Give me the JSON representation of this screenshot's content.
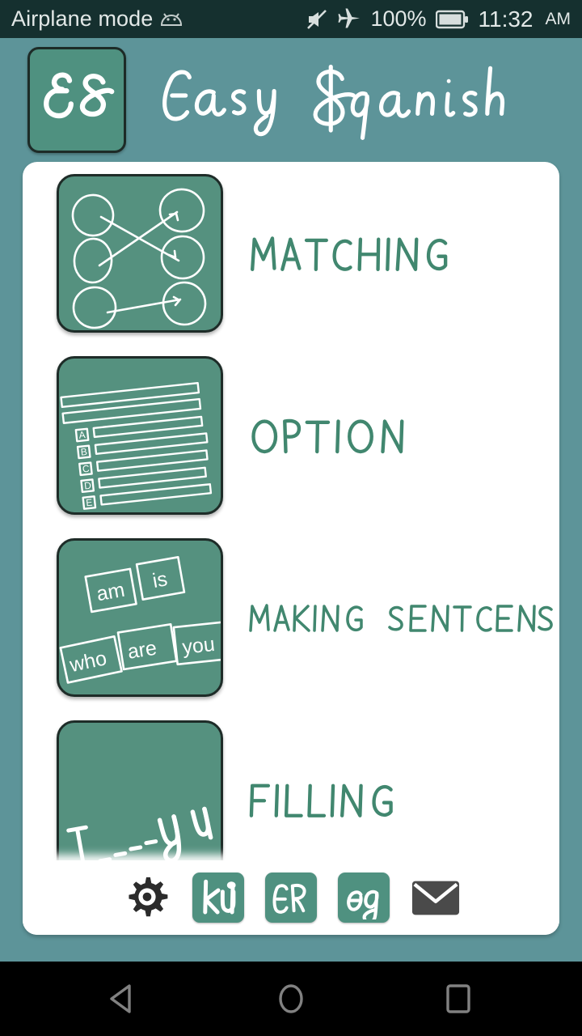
{
  "status_bar": {
    "left_text": "Airplane mode",
    "android_icon": "android-icon",
    "mute_icon": "volume-mute-icon",
    "airplane_icon": "airplane-mode-icon",
    "battery_percent": "100%",
    "battery_icon": "battery-full-icon",
    "time": "11:32",
    "ampm": "AM",
    "background_color": "#15302f",
    "text_color": "#e2e8e7"
  },
  "header": {
    "logo_text": "ES",
    "title": "Easy Spanish",
    "background_color": "#5d9499",
    "logo_tile_color": "#4f9180",
    "title_color": "#ffffff"
  },
  "colors": {
    "page_background": "#5d9499",
    "card_background": "#ffffff",
    "tile_green": "#55917f",
    "label_green": "#41876f",
    "icon_dark": "#4a4a4a"
  },
  "main": {
    "items": [
      {
        "label": "MATCHING",
        "icon": "matching-circles-icon",
        "icon_description": "six circles connected by three arrows"
      },
      {
        "label": "OPTION",
        "icon": "multiple-choice-icon",
        "icon_description": "question lines with A B C D E answer bars",
        "choices": [
          "A",
          "B",
          "C",
          "D",
          "E"
        ]
      },
      {
        "label": "MAKING SENTENCES",
        "icon": "word-tiles-icon",
        "icon_description": "scattered word tiles",
        "tiles": [
          "am",
          "is",
          "who",
          "are",
          "you"
        ]
      },
      {
        "label": "FILLING",
        "icon": "fill-in-the-blank-icon",
        "icon_description": "I ___ you handwritten blank",
        "sentence_start": "I",
        "sentence_end": "you"
      }
    ]
  },
  "toolbar": {
    "buttons": [
      {
        "name": "settings-button",
        "icon": "gear-icon",
        "label": ""
      },
      {
        "name": "kolay-ingilizce-button",
        "icon": "ku-logo-icon",
        "label": "kü"
      },
      {
        "name": "easy-russian-button",
        "icon": "er-logo-icon",
        "label": "ER"
      },
      {
        "name": "easy-german-button",
        "icon": "eg-logo-icon",
        "label": "eg"
      },
      {
        "name": "contact-button",
        "icon": "envelope-icon",
        "label": ""
      }
    ]
  },
  "nav_bar": {
    "back": "back-triangle-icon",
    "home": "home-circle-icon",
    "recents": "recents-square-icon",
    "background_color": "#000000",
    "icon_color": "#808080"
  }
}
